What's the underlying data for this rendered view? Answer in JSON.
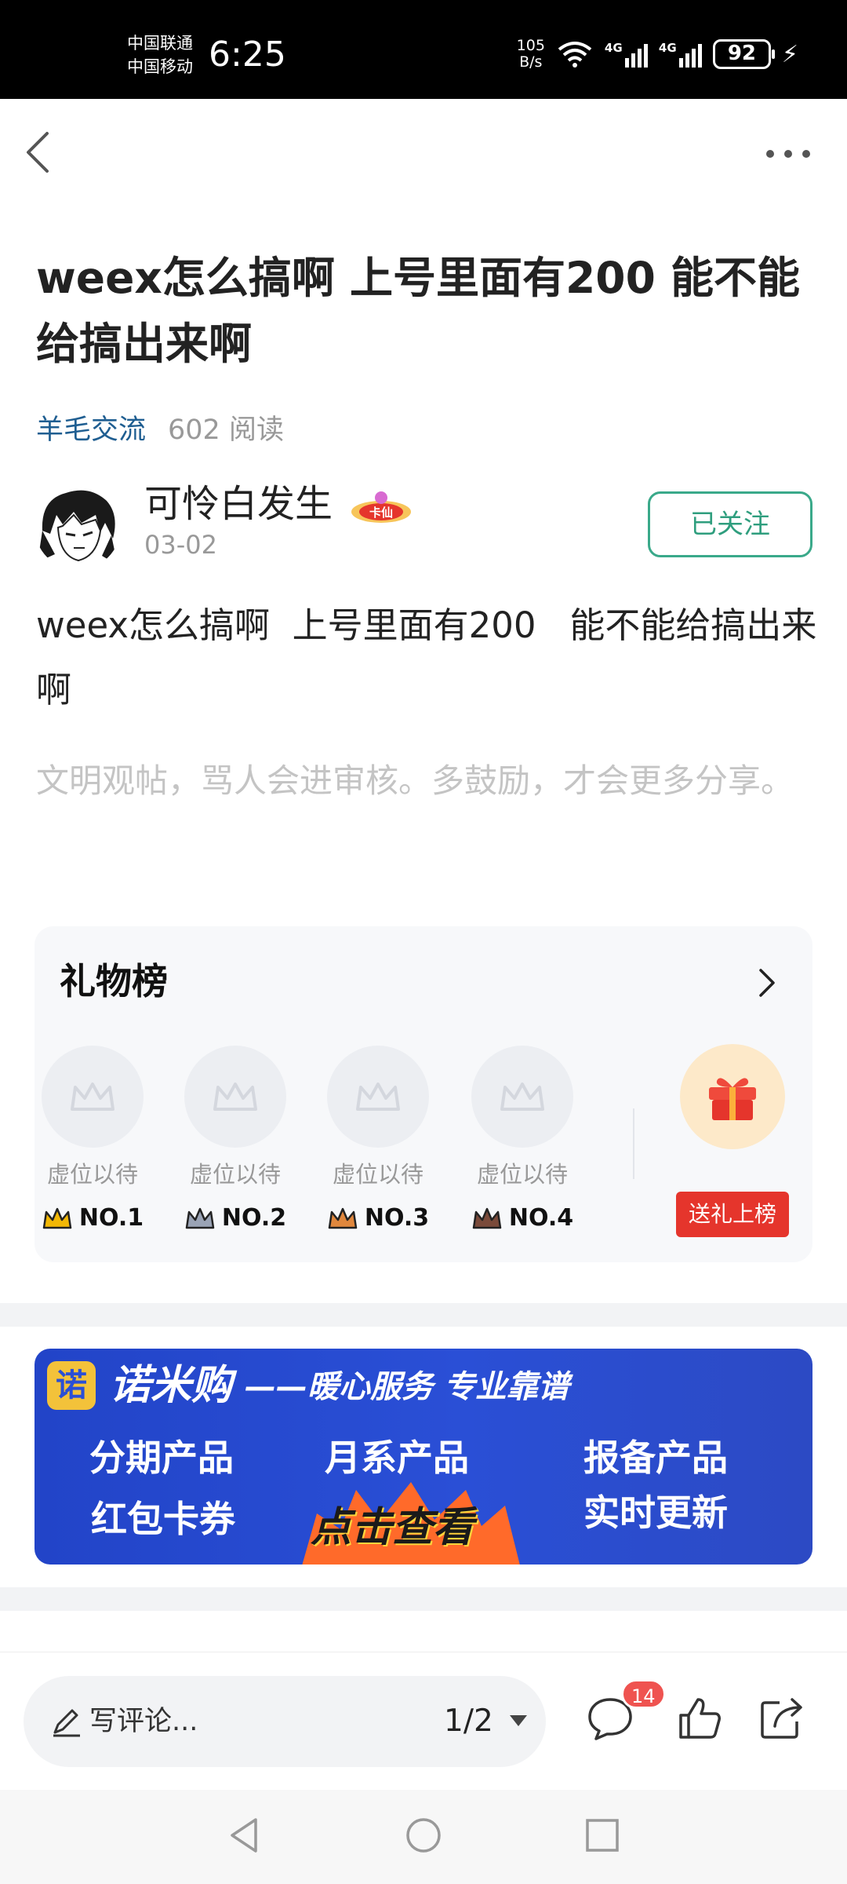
{
  "status_bar": {
    "carrier1": "中国联通",
    "carrier2": "中国移动",
    "time": "6:25",
    "net_speed_value": "105",
    "net_speed_unit": "B/s",
    "signal1_label": "4G",
    "signal2_label": "4G",
    "battery": "92"
  },
  "post": {
    "title": "weex怎么搞啊 上号里面有200 能不能给搞出来啊",
    "category": "羊毛交流",
    "reads": "602 阅读",
    "author": "可怜白发生",
    "author_badge": "卡仙",
    "date": "03-02",
    "follow_label": "已关注",
    "content": "weex怎么搞啊  上号里面有200   能不能给搞出来啊",
    "notice": "文明观帖，骂人会进审核。多鼓励，才会更多分享。"
  },
  "gift_board": {
    "title": "礼物榜",
    "slots": [
      {
        "status": "虚位以待",
        "rank": "NO.1",
        "crown_color": "#f2b705"
      },
      {
        "status": "虚位以待",
        "rank": "NO.2",
        "crown_color": "#9aa3b5"
      },
      {
        "status": "虚位以待",
        "rank": "NO.3",
        "crown_color": "#e0873d"
      },
      {
        "status": "虚位以待",
        "rank": "NO.4",
        "crown_color": "#7a4a3a"
      }
    ],
    "send_gift_label": "送礼上榜"
  },
  "banner": {
    "logo_char": "诺",
    "brand": "诺米购",
    "tagline": "——暖心服务 专业靠谱",
    "items": [
      "分期产品",
      "月系产品",
      "报备产品",
      "红包卡券",
      "实时更新"
    ],
    "cta": "点击查看"
  },
  "bottom_bar": {
    "comment_placeholder": "写评论...",
    "page_indicator": "1/2",
    "comment_count": "14"
  },
  "colors": {
    "accent_green": "#2f9e7e",
    "category_blue": "#1f5e91",
    "gift_red": "#e5352c",
    "banner_blue": "#2a4fd6"
  }
}
